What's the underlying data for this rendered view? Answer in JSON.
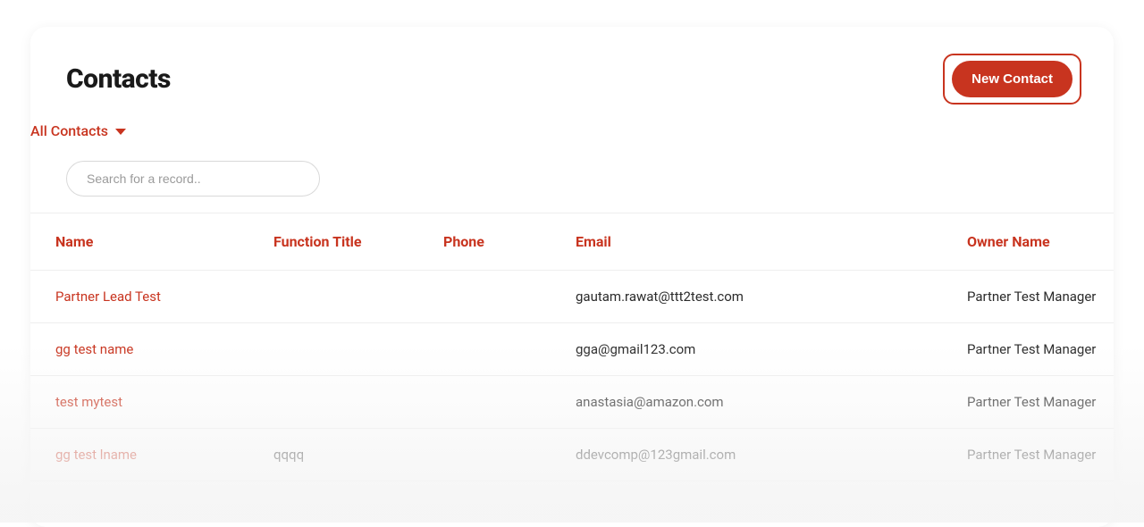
{
  "header": {
    "title": "Contacts",
    "new_contact_label": "New Contact"
  },
  "filter": {
    "label": "All Contacts"
  },
  "search": {
    "placeholder": "Search for a record.."
  },
  "table": {
    "columns": {
      "name": "Name",
      "function_title": "Function Title",
      "phone": "Phone",
      "email": "Email",
      "owner_name": "Owner Name"
    },
    "rows": [
      {
        "name": "Partner Lead Test",
        "function_title": "",
        "phone": "",
        "email": "gautam.rawat@ttt2test.com",
        "owner_name": "Partner Test Manager"
      },
      {
        "name": "gg test name",
        "function_title": "",
        "phone": "",
        "email": "gga@gmail123.com",
        "owner_name": "Partner Test Manager"
      },
      {
        "name": "test mytest",
        "function_title": "",
        "phone": "",
        "email": "anastasia@amazon.com",
        "owner_name": "Partner Test Manager"
      },
      {
        "name": "gg test lname",
        "function_title": "qqqq",
        "phone": "",
        "email": "ddevcomp@123gmail.com",
        "owner_name": "Partner Test Manager"
      }
    ]
  }
}
